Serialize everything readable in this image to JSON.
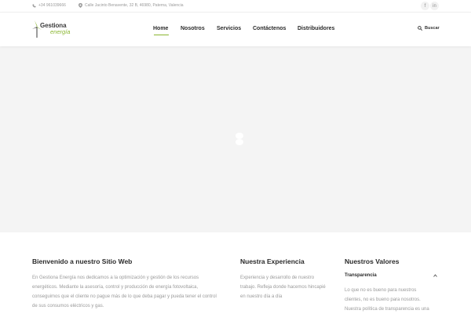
{
  "topbar": {
    "phone": "+34 961039666",
    "address": "Calle Jacinto Benavente, 32 B, 46980, Paterna, Valencia",
    "social": [
      {
        "icon": "facebook-icon",
        "glyph": "f"
      },
      {
        "icon": "linkedin-icon",
        "glyph": "in"
      }
    ]
  },
  "logo": {
    "word1": "Gestiona",
    "word2": "energía"
  },
  "nav": {
    "items": [
      "Home",
      "Nosotros",
      "Servicios",
      "Contáctenos",
      "Distribuidores"
    ],
    "active": "Home"
  },
  "search": {
    "label": "Buscar"
  },
  "sections": {
    "welcome": {
      "title": "Bienvenido a nuestro Sitio Web",
      "lines": [
        "En Gestiona Energía nos dedicamos a la optimización y gestión de los recursos",
        "energéticos.   Mediante la asesoría, control y producción de energía fotovoltaica,",
        "conseguimos que el cliente no pague más de lo que deba pagar y pueda tener el control",
        "de sus consumos eléctricos y gas."
      ]
    },
    "experience": {
      "title": "Nuestra Experiencia",
      "lines": [
        "Experiencia y desarrollo de nuestro",
        "trabajo. Refleja donde hacemos hincapié",
        "en nuestro día a día"
      ]
    },
    "values": {
      "title": "Nuestros Valores",
      "accordion_title": "Transparencia",
      "lines": [
        "Lo que no es bueno para nuestros",
        "clientes, no es bueno para nosotros.",
        "Nuestra política de transparencia es una"
      ]
    }
  },
  "colors": {
    "accent": "#8ab630",
    "hero_bg": "#f4f4f4",
    "text_muted": "#9a9a9a"
  }
}
